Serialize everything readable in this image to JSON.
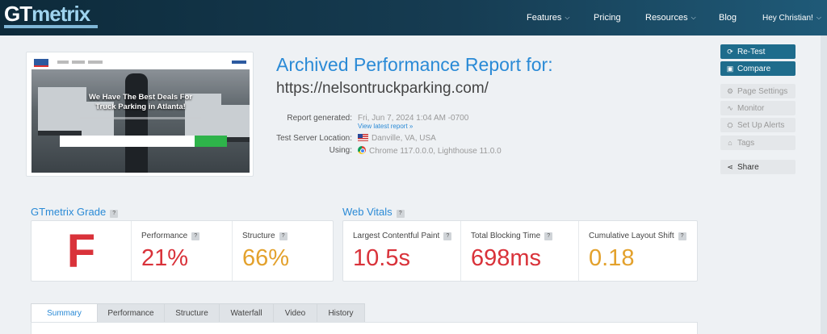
{
  "header": {
    "logo_text_gt": "GT",
    "logo_text_metrix": "metrix",
    "nav": [
      {
        "label": "Features",
        "has_chevron": true
      },
      {
        "label": "Pricing",
        "has_chevron": false
      },
      {
        "label": "Resources",
        "has_chevron": true
      },
      {
        "label": "Blog",
        "has_chevron": false
      },
      {
        "label": "Hey Christian!",
        "has_chevron": true
      }
    ]
  },
  "screenshot": {
    "headline_line1": "We Have The Best Deals For",
    "headline_line2": "Truck Parking in Atlanta!"
  },
  "report": {
    "title": "Archived Performance Report for:",
    "url": "https://nelsontruckparking.com/",
    "meta": {
      "generated_label": "Report generated:",
      "generated_value": "Fri, Jun 7, 2024 1:04 AM -0700",
      "latest_link": "View latest report »",
      "location_label": "Test Server Location:",
      "location_value": "Danville, VA, USA",
      "using_label": "Using:",
      "using_value": "Chrome 117.0.0.0, Lighthouse 11.0.0"
    }
  },
  "actions": {
    "retest": "Re-Test",
    "compare": "Compare",
    "page_settings": "Page Settings",
    "monitor": "Monitor",
    "set_up_alerts": "Set Up Alerts",
    "tags": "Tags",
    "share": "Share"
  },
  "grade": {
    "section_title": "GTmetrix Grade",
    "letter": "F",
    "performance_label": "Performance",
    "performance_value": "21%",
    "structure_label": "Structure",
    "structure_value": "66%"
  },
  "vitals": {
    "section_title": "Web Vitals",
    "lcp_label": "Largest Contentful Paint",
    "lcp_value": "10.5s",
    "tbt_label": "Total Blocking Time",
    "tbt_value": "698ms",
    "cls_label": "Cumulative Layout Shift",
    "cls_value": "0.18"
  },
  "tabs": [
    "Summary",
    "Performance",
    "Structure",
    "Waterfall",
    "Video",
    "History"
  ],
  "colors": {
    "accent_blue": "#2a8ad6",
    "grade_red": "#d9323a",
    "warning_orange": "#e3a12c",
    "button_teal": "#1e6c8c"
  }
}
